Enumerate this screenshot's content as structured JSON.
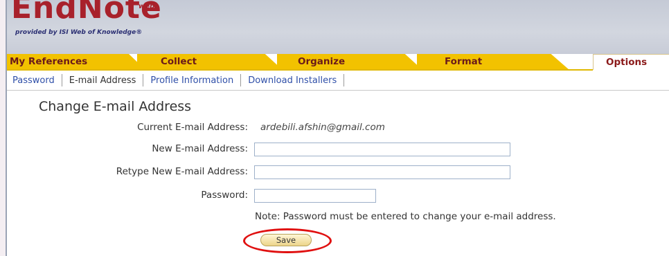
{
  "header": {
    "logo_text": "EndNote",
    "logo_sup": "web",
    "tagline": "provided by ISI Web of Knowledge"
  },
  "tabs": [
    {
      "label": "My References"
    },
    {
      "label": "Collect"
    },
    {
      "label": "Organize"
    },
    {
      "label": "Format"
    },
    {
      "label": "Options"
    }
  ],
  "subnav": [
    {
      "label": "Password"
    },
    {
      "label": "E-mail Address"
    },
    {
      "label": "Profile Information"
    },
    {
      "label": "Download Installers"
    }
  ],
  "form": {
    "title": "Change E-mail Address",
    "current_label": "Current E-mail Address:",
    "current_value": "ardebili.afshin@gmail.com",
    "new_label": "New E-mail Address:",
    "new_value": "",
    "retype_label": "Retype New E-mail Address:",
    "retype_value": "",
    "password_label": "Password:",
    "password_value": "",
    "note": "Note:  Password must be entered to change your e-mail address.",
    "save_label": "Save"
  },
  "colors": {
    "tab": "#f2c200",
    "logo": "#a8212b",
    "link": "#2f4fa8",
    "highlight": "#e01010"
  }
}
